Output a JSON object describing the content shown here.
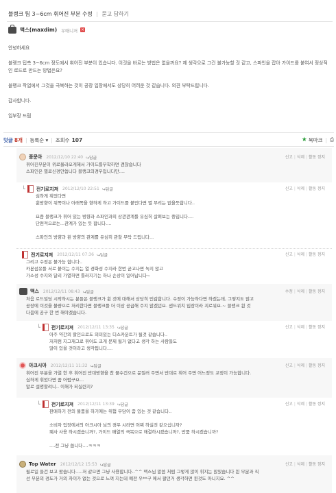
{
  "post": {
    "title": "블랭크 팁 3~6cm 휘어진 부분 수정",
    "subtitle": "묻고 답하기",
    "author": "맥스(maxdim)",
    "grade": "우매니저",
    "body": [
      "안녕하세요",
      "블랭크 팁측 3~6cm 정도에서 휘어진 부분이 있습니다. 이것을 바르는 방법은 없을까요? 제 생각으로 그건 불가능할 것 같고, 스파인을 잡아 가이드를 붙여서 정상적인 로드로 만드는 방법은요?",
      "블랭크 작업에서 그것을 극복하는 것이 공장 입장에서도 상당히 어려운 것 같습니다. 의견 부탁드립니다.",
      "감사합니다.",
      "임부장 드림"
    ]
  },
  "comment_bar": {
    "label": "덧글",
    "count": "8개",
    "sort": "등록순 ▾",
    "views_label": "조회수",
    "views": "107",
    "bookmark": "북마크",
    "print_icon": "print-icon"
  },
  "actions": {
    "report": "신고",
    "delete": "삭제",
    "block": "활동 정지",
    "edit": "수정"
  },
  "comments": [
    {
      "name": "종문아",
      "date": "2012/12/10 22:40",
      "reply": "↪답글",
      "avatar": "bunny-icon",
      "lines": [
        "휘어진부분이 위로올라오게해서 가이드를부착하면 괜찮습니다",
        "스파인은 별로신경안씁니다 블랭크의경우입니다만...."
      ]
    },
    {
      "name": "전기로지져",
      "date": "2012/12/10 22:51",
      "reply": "↪답글",
      "avatar": "doc-icon",
      "is_reply": true,
      "lines": [
        "심하게 휘었다면",
        "휜방향이 위쪽이나 아래쪽을 향하게 하고 가이드를 붙인다면 별 무리는 없을듯합니다..",
        "",
        "요즘 블랭크가 휘어 있는 방향과 스파인과의 상관관계를 유심히 살펴보는 중입니다....",
        "단편적으로는...관계가 있는 듯 합니다....",
        "",
        "스파인의 방향과 휜 방향의 관계를 유심히 관찰 부탁 드립니다..."
      ]
    },
    {
      "name": "전기로지져",
      "date": "2012/12/11 07:36",
      "reply": "↪답글",
      "avatar": "doc-icon",
      "lines": [
        "그리고 수정은 불가능 합니다..",
        "카본섬유를 서로 붙이는 수지는 열 경화성 수지라 한번 굳고나면 녹지 않고",
        "가소성 수지와 달리 가열하면 틀러지기는 하나 손상이 일어납니다~"
      ]
    },
    {
      "name": "맥스",
      "date": "2012/12/11 08:43",
      "reply": "↪답글",
      "avatar": "bag-icon",
      "lines": [
        "처음 로드빌딩 시작하시는 분들은 블랭크가 휜 것에 대해서 상당히 민감합니다. 수정이 가능하다면 하겠는데, 그렇지도 않고",
        "공장에 이것을 불량으로 처리한다면 블랭크를 더 이상 공급해 주지 않겠던요. 샌드위치 입장이라 괴로워요.~ 블랭크 휜 것",
        "다음에 공구 한 번 해야겠습니다."
      ]
    },
    {
      "name": "전기로지져",
      "date": "2012/12/11 13:35",
      "reply": "↪답글",
      "avatar": "doc-icon",
      "is_reply": true,
      "lines": [
        "아주 약간의 할인으로도 의미있는 디스카운트가 될것 같습니다..",
        "저처럼 지그재그로 휘어도 크게 문제 될거 없다고 생각 하는 사람들도",
        "많이 있을 것이라고 생각됩니다...."
      ]
    },
    {
      "name": "아크시아",
      "date": "2012/12/11 11:32",
      "reply": "↪답글",
      "avatar": "flower-icon",
      "lines": [
        "휘어진 부분을 가열 한 후 휘어진 반대방향을 찬 물수건으로 문질러 주면서 반대로 휘어 주면 어느정도 교정이 가능합니다.",
        "심하게 휘었다면 좀 어렵구요...",
        "말로 설명할려니.. 이해가 되실련지?"
      ]
    },
    {
      "name": "전기로지져",
      "date": "2012/12/11 13:39",
      "reply": "↪답글",
      "avatar": "doc-icon",
      "is_reply": true,
      "lines": [
        "판매하기 전의 물품을 하기에는 위험 부담이 좀 있는 것 같습니다..",
        "",
        "소비자 입장에서의 아크시아 님의 경우 시라면 어찌 하실것 같으십니까?",
        "폐사 사용 하시겠습니까?, 가이드 배열의 극복으로 해결하시겠습니까?, 반품 하시겠습니까?",
        "",
        "....전 그냥 씁니다....ㅋㅋㅋ"
      ]
    },
    {
      "name": "Top Water",
      "date": "2012/12/12 15:53",
      "reply": "↪답글",
      "avatar": "monkey-icon",
      "lines": [
        "될로일 들건 보고 왔습니다.....저 같으면 그냥 사용합니다..^^ 맥스님 말씀 처럼 그렇게 많이 휘지는 않았습니다 휜 부분과 직",
        "선 부분의 경도가 거의 차이가 없는 것으로 느껴 지는데 예전 우**구 에서 팔던거 생각하면 휜것도 아니지요. ^^"
      ]
    }
  ]
}
